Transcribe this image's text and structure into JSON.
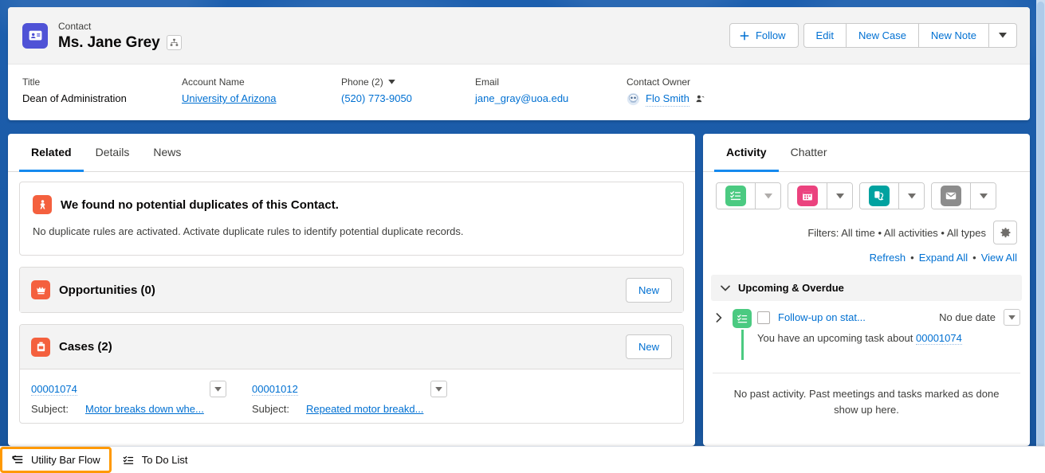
{
  "record_header": {
    "icon": "contact-card-icon",
    "eyebrow": "Contact",
    "name": "Ms. Jane Grey",
    "hierarchy_icon": "hierarchy-icon",
    "actions": {
      "follow": "Follow",
      "edit": "Edit",
      "new_case": "New Case",
      "new_note": "New Note",
      "more": "more-actions-caret"
    },
    "fields": [
      {
        "label": "Title",
        "value": "Dean of Administration"
      },
      {
        "label": "Account Name",
        "value": "University of Arizona"
      },
      {
        "label": "Phone (2)",
        "value": "(520) 773-9050"
      },
      {
        "label": "Email",
        "value": "jane_gray@uoa.edu"
      },
      {
        "label": "Contact Owner",
        "value": "Flo Smith"
      }
    ]
  },
  "main": {
    "tabs": [
      {
        "label": "Related",
        "active": true
      },
      {
        "label": "Details",
        "active": false
      },
      {
        "label": "News",
        "active": false
      }
    ],
    "duplicate_card": {
      "icon": "duplicate-check-icon",
      "title": "We found no potential duplicates of this Contact.",
      "body": "No duplicate rules are activated. Activate duplicate rules to identify potential duplicate records."
    },
    "opportunities_card": {
      "icon": "opportunity-crown-icon",
      "title": "Opportunities (0)",
      "new_label": "New"
    },
    "cases_card": {
      "icon": "case-briefcase-icon",
      "title": "Cases (2)",
      "new_label": "New",
      "subject_label": "Subject:",
      "rows": [
        {
          "number": "00001074",
          "subject": "Motor breaks down whe..."
        },
        {
          "number": "00001012",
          "subject": "Repeated motor breakd..."
        }
      ]
    }
  },
  "side": {
    "tabs": [
      {
        "label": "Activity",
        "active": true
      },
      {
        "label": "Chatter",
        "active": false
      }
    ],
    "action_buttons": [
      {
        "name": "new-task-button",
        "icon": "task-icon",
        "color": "#4bca81"
      },
      {
        "name": "new-event-button",
        "icon": "calendar-icon",
        "color": "#eb427e"
      },
      {
        "name": "log-a-call-button",
        "icon": "call-icon",
        "color": "#00a2a0"
      },
      {
        "name": "email-button",
        "icon": "email-icon",
        "color": "#8c8c8c"
      }
    ],
    "filters_text": "Filters: All time • All activities • All types",
    "settings_icon": "gear-icon",
    "links": {
      "refresh": "Refresh",
      "expand_all": "Expand All",
      "view_all": "View All",
      "separator": "•"
    },
    "upcoming": {
      "section_title": "Upcoming & Overdue",
      "task": {
        "title": "Follow-up on stat...",
        "due": "No due date",
        "description_prefix": "You have an upcoming task about",
        "related_record": "00001074"
      }
    },
    "no_past_activity": "No past activity. Past meetings and tasks marked as done show up here."
  },
  "utility_bar": {
    "items": [
      {
        "label": "Utility Bar Flow",
        "icon": "flow-icon",
        "focused": true
      },
      {
        "label": "To Do List",
        "icon": "todo-list-icon",
        "focused": false
      }
    ]
  },
  "colors": {
    "brand_blue": "#1c5ca8",
    "link": "#0070d2",
    "accent_tab": "#1589ee",
    "focus_orange": "#ff9900",
    "contact_icon": "#4f52d6",
    "orange_icon": "#f4603e"
  }
}
